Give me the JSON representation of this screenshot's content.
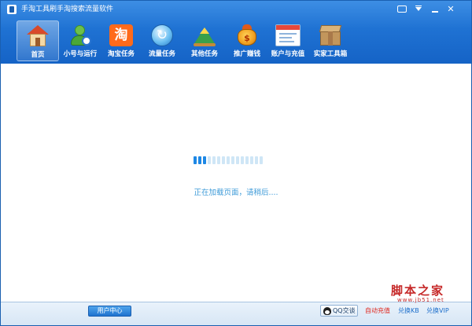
{
  "window": {
    "title": "手淘工具刷手淘搜索流量软件"
  },
  "toolbar": {
    "items": [
      {
        "label": "首页",
        "icon": "home-icon"
      },
      {
        "label": "小号与运行",
        "icon": "user-clock-icon"
      },
      {
        "label": "淘宝任务",
        "icon": "taobao-icon",
        "glyph": "淘"
      },
      {
        "label": "流量任务",
        "icon": "refresh-icon",
        "glyph": "↻"
      },
      {
        "label": "其他任务",
        "icon": "mountain-icon"
      },
      {
        "label": "推广赚钱",
        "icon": "money-bag-icon",
        "glyph": "$"
      },
      {
        "label": "账户与充值",
        "icon": "account-card-icon"
      },
      {
        "label": "实家工具箱",
        "icon": "toolbox-icon"
      }
    ],
    "active_index": 0
  },
  "content": {
    "loading_text": "正在加载页面，请稍后....",
    "loader_segments": 15,
    "loader_active_segments": 3,
    "loader_active_color": "#1e88e5",
    "loader_idle_color": "#cfe6f6"
  },
  "status_bar": {
    "user_center_label": "用户中心",
    "qq_label": "QQ交谈",
    "auto_recharge_label": "自动充值",
    "exchange_kb_label": "兑换KB",
    "exchange_vip_label": "兑换VIP"
  },
  "watermark": {
    "main": "脚本之家",
    "url": "www.jb51.net"
  },
  "colors": {
    "header_top": "#3d8ee4",
    "header_bottom": "#1563c6",
    "loading_text": "#3c9ad8",
    "auto_recharge": "#e0281e",
    "links": "#1e6fcb"
  }
}
